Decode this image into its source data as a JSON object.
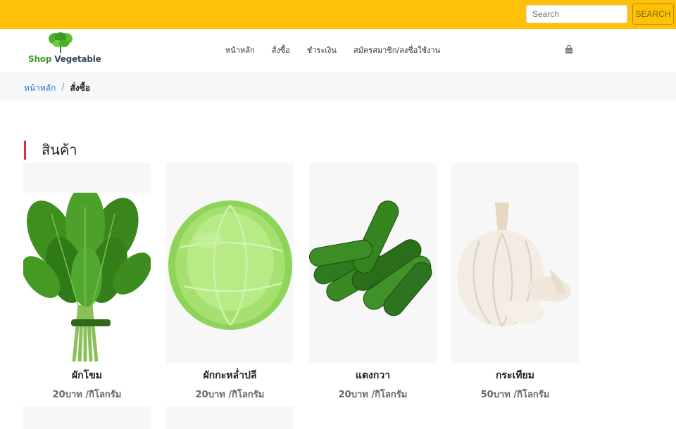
{
  "topbar": {
    "search_placeholder": "Search",
    "search_button": "SEARCH"
  },
  "logo": {
    "shop": "Shop ",
    "vegetable": "Vegetable"
  },
  "nav": {
    "items": [
      {
        "label": "หน้าหลัก"
      },
      {
        "label": "สั่งซื้อ"
      },
      {
        "label": "ชำระเงิน"
      },
      {
        "label": "สมัครสมาชิก/ลงชื่อใช้งาน"
      }
    ],
    "cart_icon": "shopping-bag-icon"
  },
  "breadcrumb": {
    "home": "หน้าหลัก",
    "separator": "/",
    "current": "สั่งซื้อ"
  },
  "section": {
    "title": "สินค้า"
  },
  "products": [
    {
      "name": "ผักโขม",
      "price": "20บาท /กิโลกรัม",
      "image": "spinach-bunch"
    },
    {
      "name": "ผักกะหล่ำปลี",
      "price": "20บาท /กิโลกรัม",
      "image": "cabbage"
    },
    {
      "name": "แตงกวา",
      "price": "20บาท /กิโลกรัม",
      "image": "cucumbers"
    },
    {
      "name": "กระเทียม",
      "price": "50บาท /กิโลกรัม",
      "image": "garlic"
    }
  ],
  "colors": {
    "topbar": "#ffc107",
    "breadcrumb_bg": "#f6f7f9",
    "accent_bar": "#e02850",
    "link": "#2a7ad0"
  }
}
